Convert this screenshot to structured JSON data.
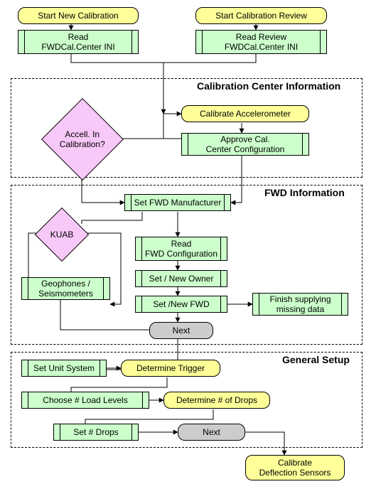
{
  "start1": "Start New Calibration",
  "start2": "Start Calibration Review",
  "readIni": "Read\nFWDCal.Center INI",
  "readReviewIni": "Read Review\nFWDCal.Center INI",
  "sec1": {
    "title": "Calibration Center Information",
    "decision": "Accell. In\nCalibration?",
    "calAccel": "Calibrate Accelerometer",
    "approve": "Approve Cal.\nCenter Configuration"
  },
  "sec2": {
    "title": "FWD Information",
    "setMfr": "Set FWD Manufacturer",
    "kuab": "KUAB",
    "geo": "Geophones /\nSeismometers",
    "readFwd": "Read\nFWD Configuration",
    "setOwner": "Set / New Owner",
    "setFwd": "Set /New FWD",
    "finish": "Finish supplying\nmissing data",
    "next": "Next"
  },
  "sec3": {
    "title": "General Setup",
    "unit": "Set Unit System",
    "trigger": "Determine Trigger",
    "loadLevels": "Choose # Load Levels",
    "drops": "Determine # of Drops",
    "setDrops": "Set # Drops",
    "next": "Next",
    "calDefl": "Calibrate\nDeflection Sensors"
  }
}
